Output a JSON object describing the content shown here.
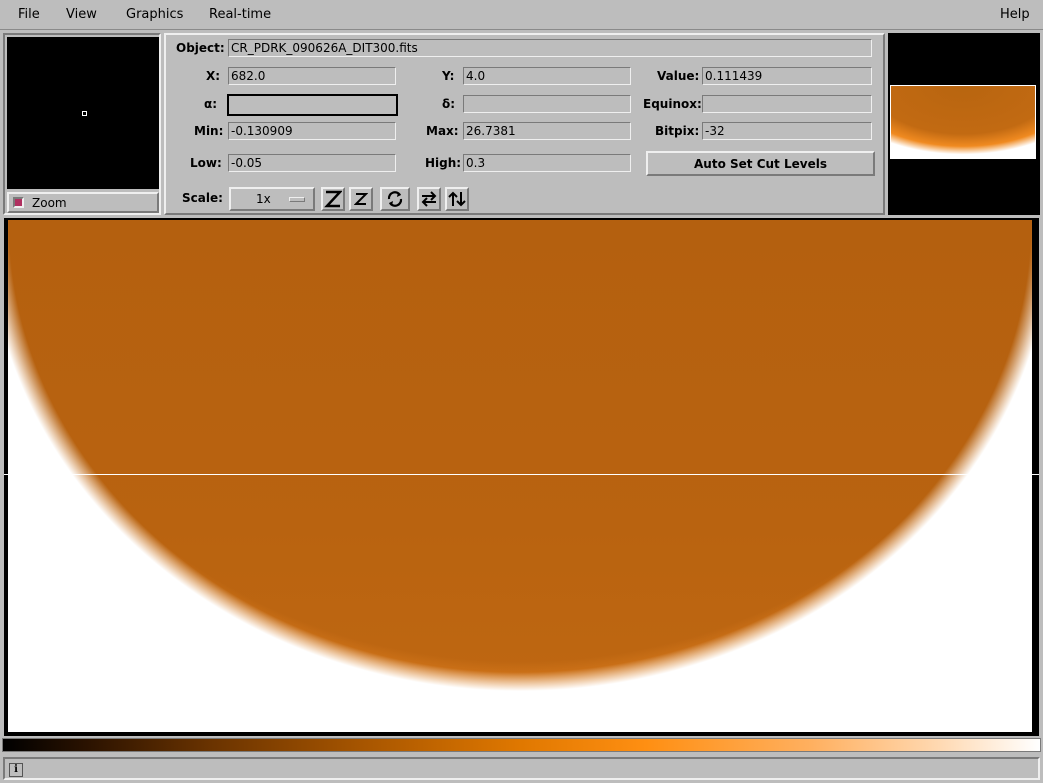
{
  "menubar": {
    "file": "File",
    "view": "View",
    "graphics": "Graphics",
    "realtime": "Real-time",
    "help": "Help"
  },
  "zoom": {
    "label": "Zoom",
    "checked": true
  },
  "info": {
    "object_label": "Object:",
    "object_value": "CR_PDRK_090626A_DIT300.fits",
    "x_label": "X:",
    "x_value": "682.0",
    "y_label": "Y:",
    "y_value": "4.0",
    "value_label": "Value:",
    "value_value": "0.111439",
    "alpha_label": "α:",
    "alpha_value": "",
    "delta_label": "δ:",
    "delta_value": "",
    "equinox_label": "Equinox:",
    "equinox_value": "",
    "min_label": "Min:",
    "min_value": "-0.130909",
    "max_label": "Max:",
    "max_value": "26.7381",
    "bitpix_label": "Bitpix:",
    "bitpix_value": "-32",
    "low_label": "Low:",
    "low_value": "-0.05",
    "high_label": "High:",
    "high_value": "0.3",
    "autocut_label": "Auto Set Cut Levels",
    "scale_label": "Scale:",
    "scale_value": "1x"
  },
  "toolbar_icons": {
    "zoom_in": "zoom-in-icon",
    "zoom_out": "zoom-out-icon",
    "rotate": "rotate-icon",
    "flip_x": "flip-x-icon",
    "flip_y": "flip-y-icon"
  },
  "colors": {
    "background": "#bdbdbd",
    "image_orange": "#b96310",
    "zoom_indicator": "#b03060"
  }
}
